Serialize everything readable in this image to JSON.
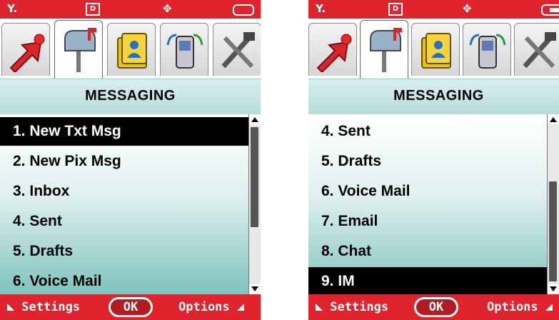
{
  "colors": {
    "status_bar": "#e0242e",
    "title_bar": "#b5dcd9",
    "selection": "#000000",
    "list_bottom": "#7fc3bd"
  },
  "screens": [
    {
      "status": {
        "signal": "Y.",
        "dataIcon": "D",
        "locationIcon": "✥",
        "battery": "battery-icon"
      },
      "tabs": [
        "recent-calls-icon",
        "messaging-mailbox-icon",
        "contacts-icon",
        "phone-tools-icon",
        "settings-tools-icon"
      ],
      "active_tab": 1,
      "title": "MESSAGING",
      "items": [
        {
          "num": "1.",
          "label": "New Txt Msg",
          "selected": true
        },
        {
          "num": "2.",
          "label": "New Pix Msg",
          "selected": false
        },
        {
          "num": "3.",
          "label": "Inbox",
          "selected": false
        },
        {
          "num": "4.",
          "label": "Sent",
          "selected": false
        },
        {
          "num": "5.",
          "label": "Drafts",
          "selected": false
        },
        {
          "num": "6.",
          "label": "Voice Mail",
          "selected": false
        }
      ],
      "scroll_position": 0.0,
      "softkeys": {
        "left": "Settings",
        "center": "OK",
        "right": "Options"
      }
    },
    {
      "status": {
        "signal": "Y.",
        "dataIcon": "D",
        "locationIcon": "✥",
        "battery": "battery-charging-icon"
      },
      "tabs": [
        "recent-calls-icon",
        "messaging-mailbox-icon",
        "contacts-icon",
        "phone-tools-icon",
        "settings-tools-icon"
      ],
      "active_tab": 1,
      "title": "MESSAGING",
      "items": [
        {
          "num": "4.",
          "label": "Sent",
          "selected": false
        },
        {
          "num": "5.",
          "label": "Drafts",
          "selected": false
        },
        {
          "num": "6.",
          "label": "Voice Mail",
          "selected": false
        },
        {
          "num": "7.",
          "label": "Email",
          "selected": false
        },
        {
          "num": "8.",
          "label": "Chat",
          "selected": false
        },
        {
          "num": "9.",
          "label": "IM",
          "selected": true
        }
      ],
      "scroll_position": 1.0,
      "softkeys": {
        "left": "Settings",
        "center": "OK",
        "right": "Options"
      }
    }
  ]
}
